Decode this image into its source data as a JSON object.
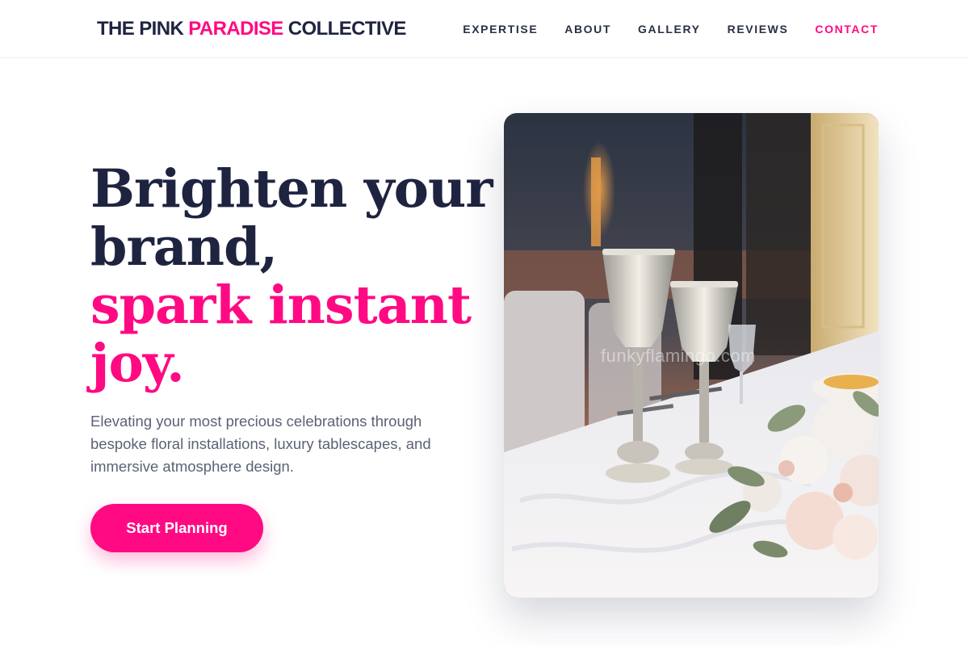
{
  "brand": {
    "part1": "THE PINK ",
    "part2": "PARADISE",
    "part3": " COLLECTIVE",
    "accent_color": "#ff0a83"
  },
  "nav": {
    "items": [
      {
        "label": "EXPERTISE"
      },
      {
        "label": "ABOUT"
      },
      {
        "label": "GALLERY"
      },
      {
        "label": "REVIEWS"
      },
      {
        "label": "CONTACT",
        "active": true
      }
    ]
  },
  "hero": {
    "headline_line1": "Brighten your",
    "headline_line2": "brand,",
    "headline_line3": "spark instant",
    "headline_line4": "joy.",
    "subtext": "Elevating your most precious celebrations through bespoke floral installations, luxury tablescapes, and immersive atmosphere design.",
    "cta_label": "Start Planning",
    "image_watermark": "funkyflamingo.com"
  },
  "colors": {
    "primary_pink": "#ff0a83",
    "navy": "#1e2440",
    "body_text": "#5b6275"
  }
}
